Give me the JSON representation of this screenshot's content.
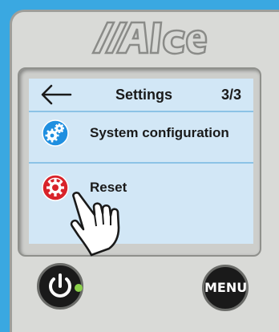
{
  "brand": {
    "logo_text": "//Alde"
  },
  "screen": {
    "title": "Settings",
    "page_indicator": "3/3",
    "back_icon": "arrow-left-icon",
    "items": [
      {
        "label": "System configuration",
        "icon": "gears-icon",
        "icon_color": "#1f8fe0"
      },
      {
        "label": "Reset",
        "icon": "reset-gear-icon",
        "icon_color": "#d8232a"
      }
    ]
  },
  "buttons": {
    "power_icon": "power-icon",
    "menu_label": "MENU"
  },
  "colors": {
    "background": "#3aa8e1",
    "screen": "#d2e7f6",
    "led": "#8bd14a"
  }
}
